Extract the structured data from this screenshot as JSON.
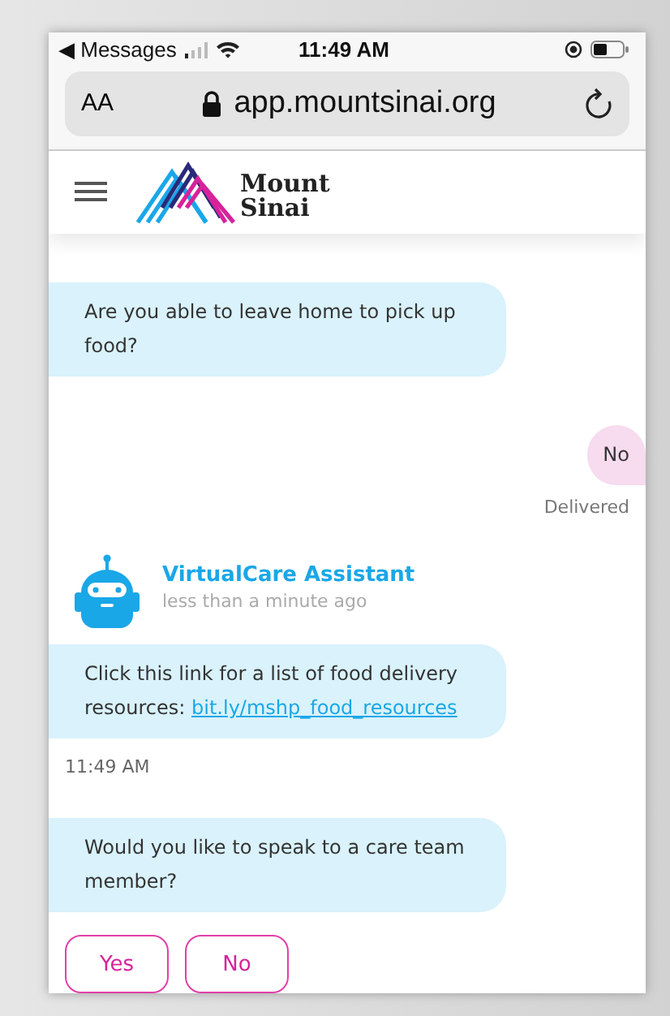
{
  "status_bar": {
    "back_label": "◀ Messages",
    "time": "11:49 AM"
  },
  "address_bar": {
    "text_size": "AA",
    "url": "app.mountsinai.org"
  },
  "header": {
    "logo_line_1": "Mount",
    "logo_line_2": "Sinai"
  },
  "messages": [
    {
      "kind": "bot",
      "text": "Are you able to leave home to pick up food?"
    },
    {
      "kind": "user",
      "text": "No"
    },
    {
      "kind": "status",
      "text": "Delivered"
    },
    {
      "kind": "agent",
      "name": "VirtualCare Assistant",
      "time": "less than a minute ago"
    },
    {
      "kind": "bot",
      "text": "Click this link for a list of food delivery resources: ",
      "link": "bit.ly/mshp_food_resources"
    },
    {
      "kind": "time",
      "text": "11:49 AM"
    },
    {
      "kind": "bot",
      "text": "Would you like to speak to a care team member?"
    },
    {
      "kind": "replies",
      "options": [
        "Yes",
        "No"
      ]
    }
  ]
}
